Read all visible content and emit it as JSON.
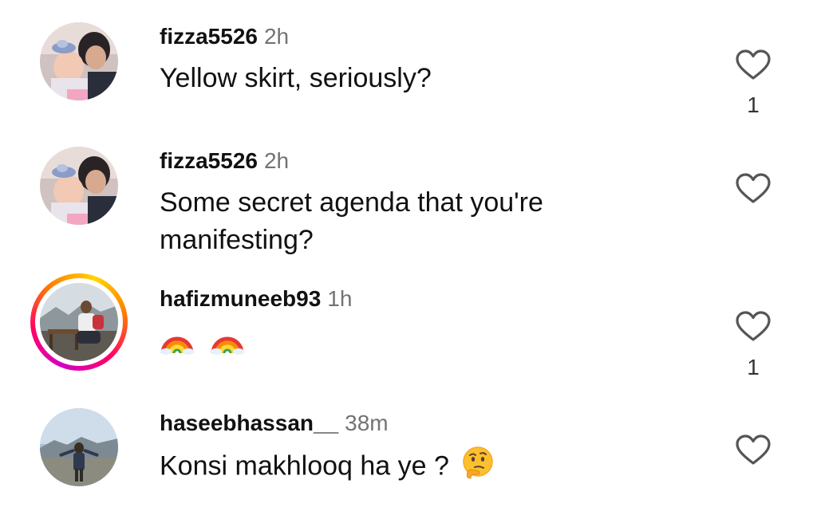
{
  "comments": [
    {
      "username": "fizza5526",
      "time": "2h",
      "text": "Yellow skirt,  seriously?",
      "likes": "1",
      "has_story": false
    },
    {
      "username": "fizza5526",
      "time": "2h",
      "text": "Some secret agenda that you're manifesting?",
      "likes": "",
      "has_story": false
    },
    {
      "username": "hafizmuneeb93",
      "time": "1h",
      "text": "",
      "emojis": [
        "rainbow",
        "rainbow"
      ],
      "likes": "1",
      "has_story": true
    },
    {
      "username": "haseebhassan__",
      "time": "38m",
      "text": "Konsi makhlooq ha ye ?",
      "emojis": [
        "thinking-face"
      ],
      "likes": "",
      "has_story": false
    }
  ],
  "icons": {
    "like": "heart-outline-icon"
  },
  "colors": {
    "text": "#111111",
    "timestamp": "#737373",
    "story_ring": [
      "#d300c5",
      "#ff0069",
      "#ff7a00",
      "#ffd600"
    ]
  }
}
